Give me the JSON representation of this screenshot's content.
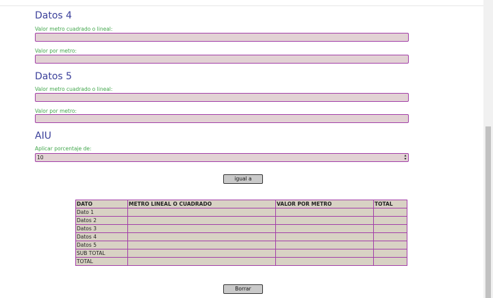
{
  "sections": [
    {
      "title": "Datos 4",
      "fields": [
        {
          "label": "Valor metro cuadrado o lineal:",
          "value": ""
        },
        {
          "label": "Valor por metro:",
          "value": ""
        }
      ]
    },
    {
      "title": "Datos 5",
      "fields": [
        {
          "label": "Valor metro cuadrado o lineal:",
          "value": ""
        },
        {
          "label": "Valor por metro:",
          "value": ""
        }
      ]
    }
  ],
  "aiu": {
    "title": "AIU",
    "label": "Aplicar porcentaje de:",
    "value": "10"
  },
  "buttons": {
    "equals": "igual a",
    "clear": "Borrar"
  },
  "table": {
    "headers": [
      "DATO",
      "METRO LINEAL O CUADRADO",
      "VALOR POR METRO",
      "TOTAL"
    ],
    "rows": [
      [
        "Dato 1",
        "",
        "",
        ""
      ],
      [
        "Datos 2",
        "",
        "",
        ""
      ],
      [
        "Datos 3",
        "",
        "",
        ""
      ],
      [
        "Datos 4",
        "",
        "",
        ""
      ],
      [
        "Datos 5",
        "",
        "",
        ""
      ],
      [
        "SUB TOTAL",
        "",
        "",
        ""
      ],
      [
        "TOTAL",
        "",
        "",
        ""
      ]
    ]
  },
  "colors": {
    "title": "#3a3f9a",
    "label": "#3fa54a",
    "field_bg": "#e2d2d4",
    "field_border": "#a23ea8",
    "table_bg": "#d8d2c4"
  }
}
